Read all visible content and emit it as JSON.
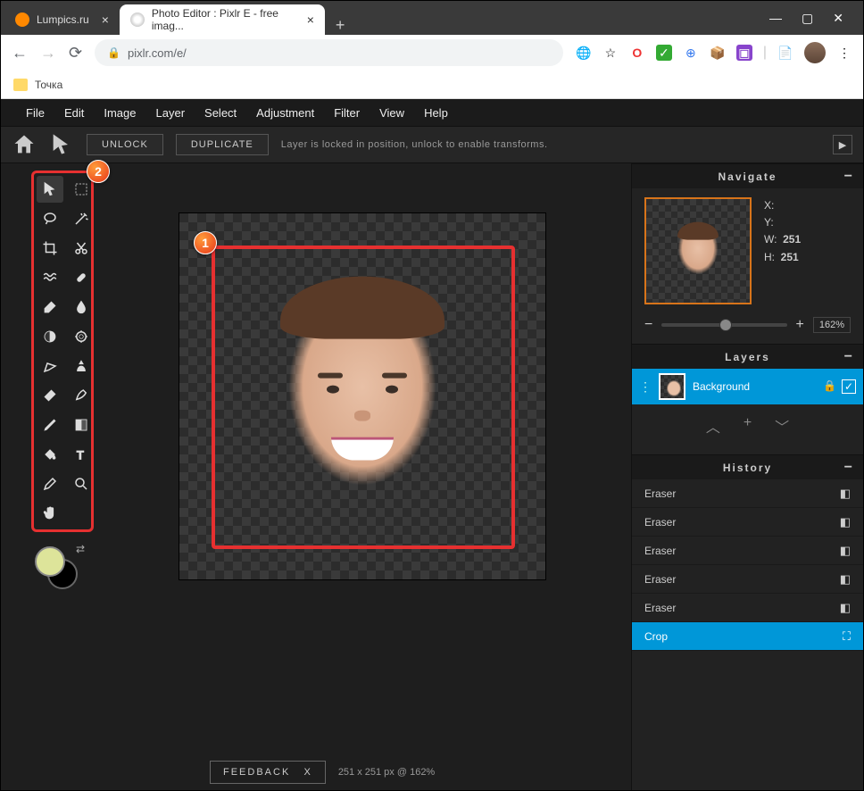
{
  "browser": {
    "tabs": [
      {
        "title": "Lumpics.ru",
        "active": false
      },
      {
        "title": "Photo Editor : Pixlr E - free imag...",
        "active": true
      }
    ],
    "url": "pixlr.com/e/",
    "bookmark": "Точка"
  },
  "menubar": [
    "File",
    "Edit",
    "Image",
    "Layer",
    "Select",
    "Adjustment",
    "Filter",
    "View",
    "Help"
  ],
  "optbar": {
    "unlock": "UNLOCK",
    "duplicate": "DUPLICATE",
    "info": "Layer is locked in position, unlock to enable transforms."
  },
  "tools": [
    "arrow-tool",
    "marquee-tool",
    "lasso-tool",
    "wand-tool",
    "crop-tool",
    "cutout-tool",
    "liquify-tool",
    "heal-tool",
    "brush-tool",
    "blur-tool",
    "dodge-tool",
    "sponge-tool",
    "pen-tool",
    "clone-tool",
    "eraser-tool",
    "smudge-tool",
    "pencil-tool",
    "gradient-tool",
    "fill-tool",
    "text-tool",
    "picker-tool",
    "zoom-tool",
    "hand-tool"
  ],
  "annotations": {
    "1": "1",
    "2": "2"
  },
  "navigate": {
    "title": "Navigate",
    "x_label": "X:",
    "y_label": "Y:",
    "w_label": "W:",
    "h_label": "H:",
    "w": "251",
    "h": "251",
    "zoom_minus": "−",
    "zoom_plus": "+",
    "zoom": "162%"
  },
  "layers": {
    "title": "Layers",
    "items": [
      {
        "name": "Background"
      }
    ]
  },
  "history": {
    "title": "History",
    "items": [
      {
        "name": "Eraser",
        "icon": "eraser-icon"
      },
      {
        "name": "Eraser",
        "icon": "eraser-icon"
      },
      {
        "name": "Eraser",
        "icon": "eraser-icon"
      },
      {
        "name": "Eraser",
        "icon": "eraser-icon"
      },
      {
        "name": "Eraser",
        "icon": "eraser-icon"
      },
      {
        "name": "Crop",
        "icon": "crop-icon",
        "active": true
      }
    ]
  },
  "footer": {
    "feedback": "FEEDBACK",
    "close": "X",
    "status": "251 x 251 px @ 162%"
  }
}
